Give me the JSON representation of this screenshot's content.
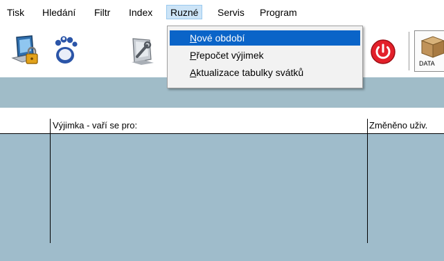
{
  "menubar": {
    "items": [
      "Tisk",
      "Hledání",
      "Filtr",
      "Index",
      "Ruzné",
      "Servis",
      "Program"
    ],
    "active": "Ruzné"
  },
  "dropdown": {
    "items": [
      {
        "key": "N",
        "rest": "ové období",
        "selected": true
      },
      {
        "key": "P",
        "rest": "řepočet výjimek",
        "selected": false
      },
      {
        "key": "A",
        "rest": "ktualizace tabulky svátků",
        "selected": false
      }
    ]
  },
  "toolbar": {
    "icons": [
      "lock-computer-icon",
      "footprint-icon",
      "tools-icon",
      "power-icon",
      "data-box-icon"
    ],
    "data_label": "DATA"
  },
  "grid": {
    "columns": [
      "",
      "Výjimka - vaří se pro:",
      "Změněno uživ."
    ]
  },
  "colors": {
    "grid_bg": "#9fbccb",
    "band_bg": "#a0bcc8",
    "selection": "#0a64c8",
    "power_red": "#e3202a"
  }
}
